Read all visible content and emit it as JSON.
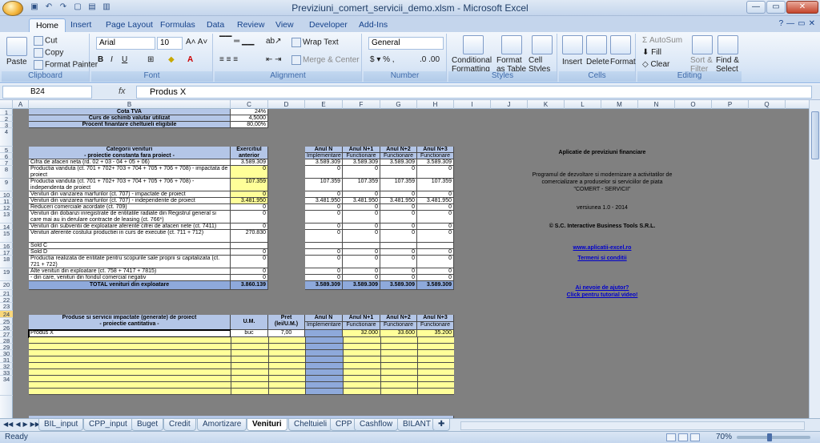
{
  "window": {
    "title": "Previziuni_comert_servicii_demo.xlsm - Microsoft Excel"
  },
  "ribbon_tabs": [
    "Home",
    "Insert",
    "Page Layout",
    "Formulas",
    "Data",
    "Review",
    "View",
    "Developer",
    "Add-Ins"
  ],
  "ribbon": {
    "clipboard": {
      "label": "Clipboard",
      "paste": "Paste",
      "cut": "Cut",
      "copy": "Copy",
      "format_painter": "Format Painter"
    },
    "font": {
      "label": "Font",
      "family": "Arial",
      "size": "10"
    },
    "alignment": {
      "label": "Alignment",
      "wrap": "Wrap Text",
      "merge": "Merge & Center"
    },
    "number": {
      "label": "Number",
      "format": "General"
    },
    "styles": {
      "label": "Styles",
      "conditional": "Conditional",
      "formatting": "Formatting",
      "format_as": "Format",
      "as_table": "as Table",
      "cell": "Cell",
      "styles": "Styles"
    },
    "cells": {
      "label": "Cells",
      "insert": "Insert",
      "delete": "Delete",
      "format": "Format"
    },
    "editing": {
      "label": "Editing",
      "autosum": "AutoSum",
      "fill": "Fill",
      "clear": "Clear",
      "sort": "Sort &",
      "filter": "Filter",
      "find": "Find &",
      "select": "Select"
    }
  },
  "formula_bar": {
    "name_box": "B24",
    "fx": "fx",
    "content": "Produs X"
  },
  "columns": [
    "A",
    "B",
    "C",
    "D",
    "E",
    "F",
    "G",
    "H",
    "I",
    "J",
    "K",
    "L",
    "M",
    "N",
    "O",
    "P",
    "Q"
  ],
  "rows": {
    "r1": {
      "label": "Cota TVA",
      "value": "24%"
    },
    "r2": {
      "label": "Curs de schimb valutar utilizat",
      "value": "4,5000"
    },
    "r3": {
      "label": "Procent finantare cheltuieli eligibile",
      "value": "80,00%"
    },
    "header1": {
      "cat": "Categorii venituri",
      "cat2": "- proiectie constanta fara proiect -",
      "prev": "Exercitiul anterior",
      "ann": "Anul N",
      "ann1": "Anul N+1",
      "ann2": "Anul N+2",
      "ann3": "Anul N+3",
      "impl": "Implementare",
      "func": "Functionare"
    },
    "items": [
      {
        "n": "7",
        "label": "Cifra de afaceri neta (rd. 02 + 03 - 04 + 05 + 06)",
        "prev": "3.589.309",
        "a": "3.589.309",
        "b": "3.589.309",
        "c": "3.589.309",
        "d": "3.589.309"
      },
      {
        "n": "8",
        "label": "Productia vanduta (ct. 701 + 702+ 703 + 704 + 705 + 706 + 708) - impactata de proiect",
        "prev": "0",
        "a": "0",
        "b": "0",
        "c": "0",
        "d": "0"
      },
      {
        "n": "9",
        "label": "Productia vanduta (ct. 701 + 702+ 703 + 704 + 705 + 706 + 708) - independenta de proiect",
        "prev": "107.359",
        "a": "107.359",
        "b": "107.359",
        "c": "107.359",
        "d": "107.359"
      },
      {
        "n": "10",
        "label": "Venituri din vanzarea marfurilor (ct. 707) - impactate de proiect",
        "prev": "0",
        "a": "0",
        "b": "0",
        "c": "0",
        "d": "0"
      },
      {
        "n": "11",
        "label": "Venituri din vanzarea marfurilor (ct. 707) - independente de proiect",
        "prev": "3.481.950",
        "a": "3.481.950",
        "b": "3.481.950",
        "c": "3.481.950",
        "d": "3.481.950"
      },
      {
        "n": "12",
        "label": "Reduceri comerciale acordate (ct. 709)",
        "prev": "0",
        "a": "0",
        "b": "0",
        "c": "0",
        "d": "0"
      },
      {
        "n": "13",
        "label": "Venituri din dobanzi inregistrate de entitatile radiate din Registrul general si care mai au in derulare contracte de leasing (ct. 766*)",
        "prev": "0",
        "a": "0",
        "b": "0",
        "c": "0",
        "d": "0"
      },
      {
        "n": "14",
        "label": "Venituri din subventii de exploatare aferente cifrei de afaceri nete (ct. 7411)",
        "prev": "0",
        "a": "0",
        "b": "0",
        "c": "0",
        "d": "0"
      },
      {
        "n": "15",
        "label": "Venituri aferente costului productiei in curs de executie (ct. 711 + 712)",
        "prev": "270.830",
        "a": "0",
        "b": "0",
        "c": "0",
        "d": "0"
      },
      {
        "n": "16",
        "label": "Sold C",
        "prev": "",
        "a": "",
        "b": "",
        "c": "",
        "d": ""
      },
      {
        "n": "17",
        "label": "Sold D",
        "prev": "0",
        "a": "0",
        "b": "0",
        "c": "0",
        "d": "0"
      },
      {
        "n": "18",
        "label": "Productia realizata de entitate pentru scopurile sale proprii si capitalizata (ct. 721 + 722)",
        "prev": "0",
        "a": "0",
        "b": "0",
        "c": "0",
        "d": "0"
      },
      {
        "n": "19",
        "label": "Alte venituri din exploatare (ct. 758 + 7417 + 7815)",
        "prev": "0",
        "a": "0",
        "b": "0",
        "c": "0",
        "d": "0"
      },
      {
        "n": "19b",
        "label": "- din care, venituri din fondul comercial negativ",
        "prev": "0",
        "a": "0",
        "b": "0",
        "c": "0",
        "d": "0"
      },
      {
        "n": "20",
        "label": "TOTAL venituri din exploatare",
        "prev": "3.860.139",
        "a": "3.589.309",
        "b": "3.589.309",
        "c": "3.589.309",
        "d": "3.589.309"
      }
    ],
    "header2": {
      "prod": "Produse si servicii impactate (generate) de proiect",
      "prod2": "- proiectie cantitativa -",
      "um": "U.M.",
      "pret": "Pret",
      "pret2": "(lei/U.M.)",
      "ann": "Anul N",
      "ann1": "Anul N+1",
      "ann2": "Anul N+2",
      "ann3": "Anul N+3",
      "impl": "Implementare",
      "func": "Functionare"
    },
    "r24": {
      "label": "Produs X",
      "um": "buc",
      "pret": "7,00",
      "a": "",
      "b": "32.000",
      "c": "33.600",
      "d": "35.200"
    }
  },
  "info": {
    "title": "Aplicatie de previziuni financiare",
    "l1": "Programul de dezvoltare si modernizare a activitatilor de",
    "l2": "comercializare a produselor si serviciilor de piata",
    "l3": "\"COMERT - SERVICII\"",
    "version": "versiunea 1.0 - 2014",
    "copyright": "© S.C. Interactive Business Tools S.R.L.",
    "site": "www.aplicatii-excel.ro",
    "terms": "Termeni si conditii",
    "help1": "Ai nevoie de ajutor?",
    "help2": "Click pentru tutorial video!"
  },
  "sheet_tabs": [
    "BIL_input",
    "CPP_input",
    "Buget",
    "Credit",
    "Amortizare",
    "Venituri",
    "Cheltuieli",
    "CPP",
    "Cashflow",
    "BILANT"
  ],
  "active_tab": "Venituri",
  "status": {
    "ready": "Ready",
    "zoom": "70%"
  }
}
